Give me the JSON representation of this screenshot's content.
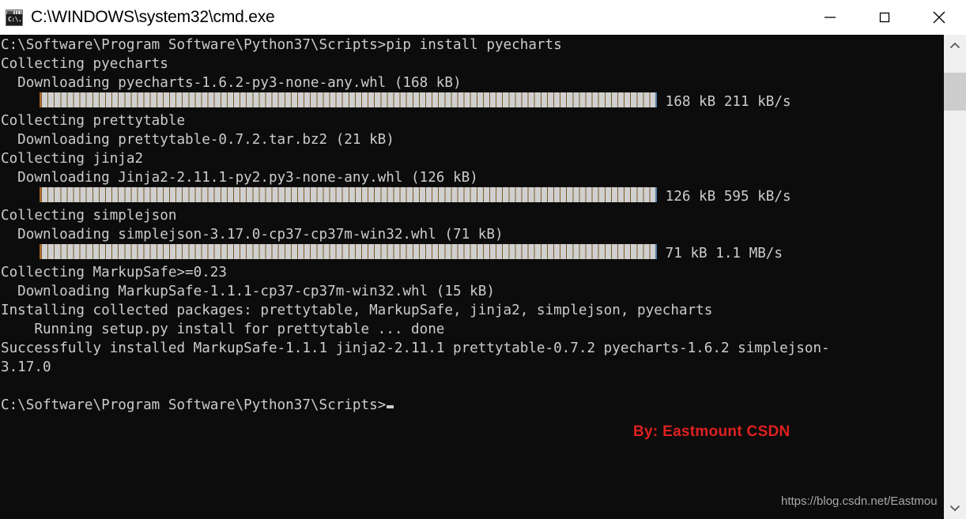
{
  "window": {
    "title": "C:\\WINDOWS\\system32\\cmd.exe",
    "icon": "cmd-icon",
    "icon_glyph": "C:\\.",
    "background_color": "#0c0c0c",
    "titlebar_color": "#ffffff",
    "text_color": "#cccccc"
  },
  "controls": {
    "minimize": "minimize-button",
    "maximize": "maximize-button",
    "close": "close-button"
  },
  "terminal": {
    "lines": [
      {
        "type": "text",
        "text": "C:\\Software\\Program Software\\Python37\\Scripts>pip install pyecharts"
      },
      {
        "type": "text",
        "text": "Collecting pyecharts"
      },
      {
        "type": "text",
        "text": "  Downloading pyecharts-1.6.2-py3-none-any.whl (168 kB)"
      },
      {
        "type": "progress",
        "indent": 5,
        "blocks": 96,
        "label": " 168 kB 211 kB/s"
      },
      {
        "type": "text",
        "text": "Collecting prettytable"
      },
      {
        "type": "text",
        "text": "  Downloading prettytable-0.7.2.tar.bz2 (21 kB)"
      },
      {
        "type": "text",
        "text": "Collecting jinja2"
      },
      {
        "type": "text",
        "text": "  Downloading Jinja2-2.11.1-py2.py3-none-any.whl (126 kB)"
      },
      {
        "type": "progress",
        "indent": 5,
        "blocks": 96,
        "label": " 126 kB 595 kB/s"
      },
      {
        "type": "text",
        "text": "Collecting simplejson"
      },
      {
        "type": "text",
        "text": "  Downloading simplejson-3.17.0-cp37-cp37m-win32.whl (71 kB)"
      },
      {
        "type": "progress",
        "indent": 5,
        "blocks": 96,
        "label": " 71 kB 1.1 MB/s"
      },
      {
        "type": "text",
        "text": "Collecting MarkupSafe>=0.23"
      },
      {
        "type": "text",
        "text": "  Downloading MarkupSafe-1.1.1-cp37-cp37m-win32.whl (15 kB)"
      },
      {
        "type": "text",
        "text": "Installing collected packages: prettytable, MarkupSafe, jinja2, simplejson, pyecharts"
      },
      {
        "type": "text",
        "text": "    Running setup.py install for prettytable ... done"
      },
      {
        "type": "text",
        "text": "Successfully installed MarkupSafe-1.1.1 jinja2-2.11.1 prettytable-0.7.2 pyecharts-1.6.2 simplejson-"
      },
      {
        "type": "text",
        "text": "3.17.0"
      },
      {
        "type": "blank",
        "text": " "
      },
      {
        "type": "prompt",
        "text": "C:\\Software\\Program Software\\Python37\\Scripts>"
      }
    ]
  },
  "watermarks": {
    "author": "By: Eastmount CSDN",
    "author_color": "#e02020",
    "url": "https://blog.csdn.net/Eastmou",
    "url_color": "#a8a8a8"
  },
  "scrollbar": {
    "up_arrow": "chevron-up-icon",
    "down_arrow": "chevron-down-icon",
    "thumb_position_percent": 4
  }
}
